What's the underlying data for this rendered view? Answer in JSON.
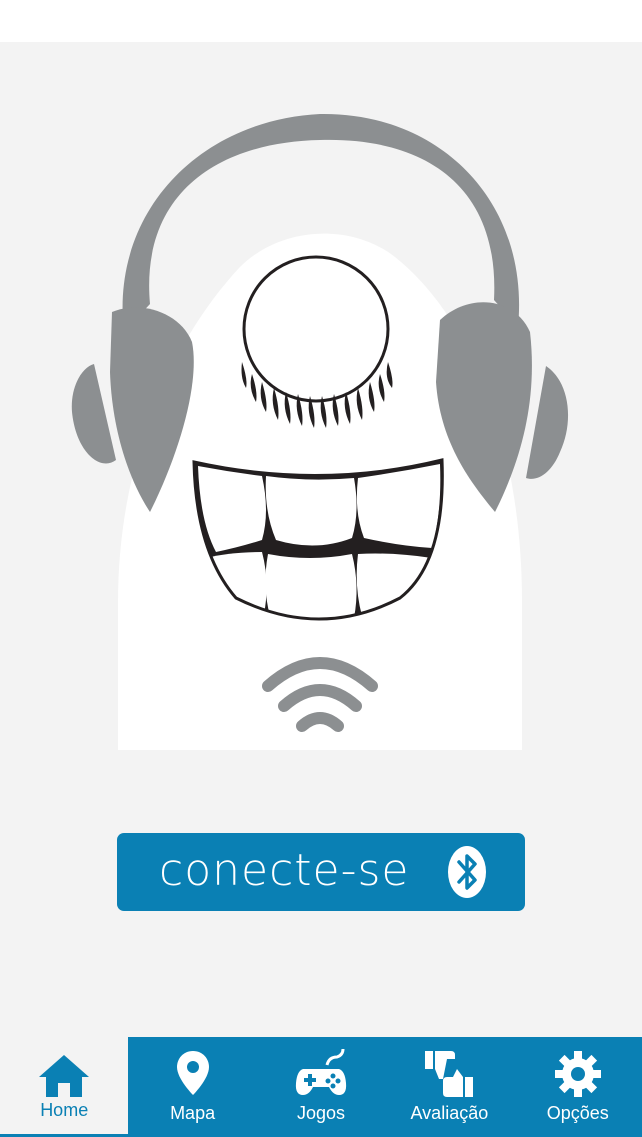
{
  "connect": {
    "label": "conecte-se",
    "icon": "bluetooth-icon"
  },
  "tabs": [
    {
      "label": "Home",
      "icon": "home-icon",
      "active": true
    },
    {
      "label": "Mapa",
      "icon": "map-pin-icon",
      "active": false
    },
    {
      "label": "Jogos",
      "icon": "gamepad-icon",
      "active": false
    },
    {
      "label": "Avaliação",
      "icon": "thumbs-icon",
      "active": false
    },
    {
      "label": "Opções",
      "icon": "gear-icon",
      "active": false
    }
  ],
  "colors": {
    "accent": "#0a80b4",
    "background": "#f3f3f3",
    "headphones": "#8c8f91"
  }
}
